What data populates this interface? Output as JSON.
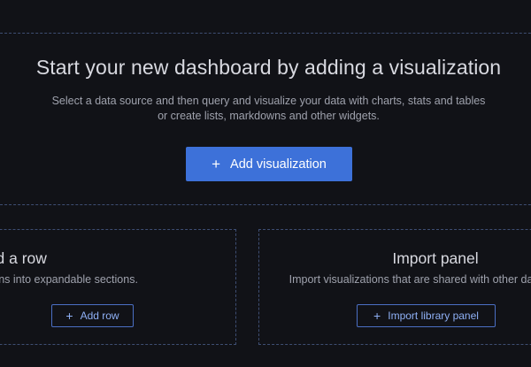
{
  "main": {
    "title": "Start your new dashboard by adding a visualization",
    "description_line1": "Select a data source and then query and visualize your data with charts, stats and tables",
    "description_line2": "or create lists, markdowns and other widgets.",
    "add_visualization_label": "Add visualization",
    "plus_icon": "+"
  },
  "row_card": {
    "title": "Add a row",
    "description": "Group your visualizations into expandable sections.",
    "button_label": "Add row",
    "plus_icon": "+"
  },
  "import_card": {
    "title": "Import panel",
    "description": "Import visualizations that are shared with other dashboards.",
    "button_label": "Import library panel",
    "plus_icon": "+"
  },
  "colors": {
    "background": "#111217",
    "primary_button": "#3d71d9",
    "card_border": "#3e4e73",
    "outline_button_text": "#8fb0f5"
  }
}
